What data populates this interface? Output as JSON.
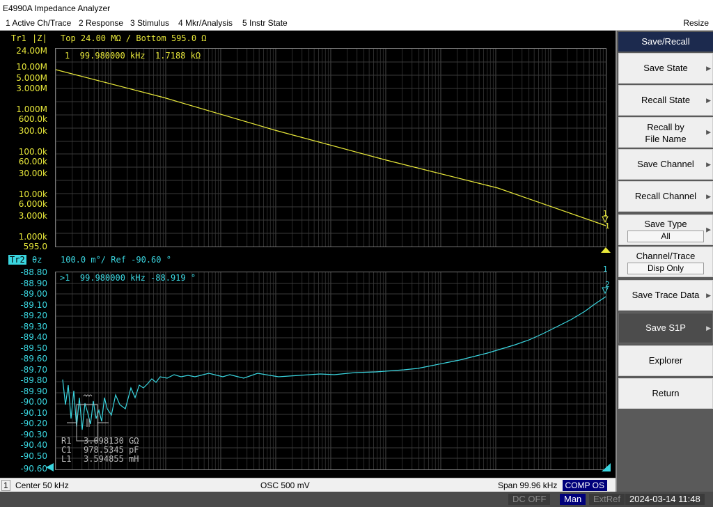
{
  "window": {
    "title": "E4990A Impedance Analyzer",
    "resize_label": "Resize"
  },
  "menu": [
    {
      "label": "1 Active Ch/Trace"
    },
    {
      "label": "2 Response"
    },
    {
      "label": "3 Stimulus"
    },
    {
      "label": "4 Mkr/Analysis"
    },
    {
      "label": "5 Instr State"
    }
  ],
  "trace1": {
    "name": "Tr1",
    "param": "|Z|",
    "scale_text": "Top 24.00 MΩ / Bottom 595.0 Ω",
    "marker_text": "1  99.980000 kHz  1.7188 kΩ",
    "marker_label": "1",
    "y_labels": [
      "24.00M",
      "10.00M",
      "5.000M",
      "3.000M",
      "1.000M",
      "600.0k",
      "300.0k",
      "100.0k",
      "60.00k",
      "30.00k",
      "10.00k",
      "6.000k",
      "3.000k",
      "1.000k",
      "595.0"
    ],
    "color": "#e8e83a"
  },
  "trace2": {
    "name": "Tr2",
    "param": "θz",
    "scale_text": "100.0 m°/ Ref -90.60 °",
    "marker_text": ">1  99.980000 kHz -88.919 °",
    "marker_label": "1",
    "marker_label2": "2",
    "y_labels": [
      "-88.80",
      "-88.90",
      "-89.00",
      "-89.10",
      "-89.20",
      "-89.30",
      "-89.40",
      "-89.50",
      "-89.60",
      "-89.70",
      "-89.80",
      "-89.90",
      "-90.00",
      "-90.10",
      "-90.20",
      "-90.30",
      "-90.40",
      "-90.50",
      "-90.60"
    ],
    "equiv": [
      {
        "label": "R1",
        "value": "3.098130 GΩ"
      },
      {
        "label": "C1",
        "value": "978.5345 pF"
      },
      {
        "label": "L1",
        "value": "3.594855 mH"
      }
    ],
    "color": "#3ad6e0"
  },
  "status": {
    "channel": "1",
    "center": "Center  50 kHz",
    "osc": "OSC 500 mV",
    "span": "Span 99.96 kHz",
    "comp": "COMP OS"
  },
  "bottom": {
    "dc": "DC OFF",
    "mode": "Man",
    "ref": "ExtRef",
    "datetime": "2024-03-14 11:48"
  },
  "softkeys": {
    "title": "Save/Recall",
    "items": [
      {
        "label": "Save State"
      },
      {
        "label": "Recall State"
      },
      {
        "label": "Recall by",
        "label2": "File Name"
      },
      {
        "label": "Save Channel"
      },
      {
        "label": "Recall Channel"
      },
      {
        "label": "Save Type",
        "value": "All"
      },
      {
        "label": "Channel/Trace",
        "value": "Disp Only"
      },
      {
        "label": "Save Trace Data"
      },
      {
        "label": "Save S1P"
      },
      {
        "label": "Explorer"
      },
      {
        "label": "Return"
      }
    ]
  }
}
